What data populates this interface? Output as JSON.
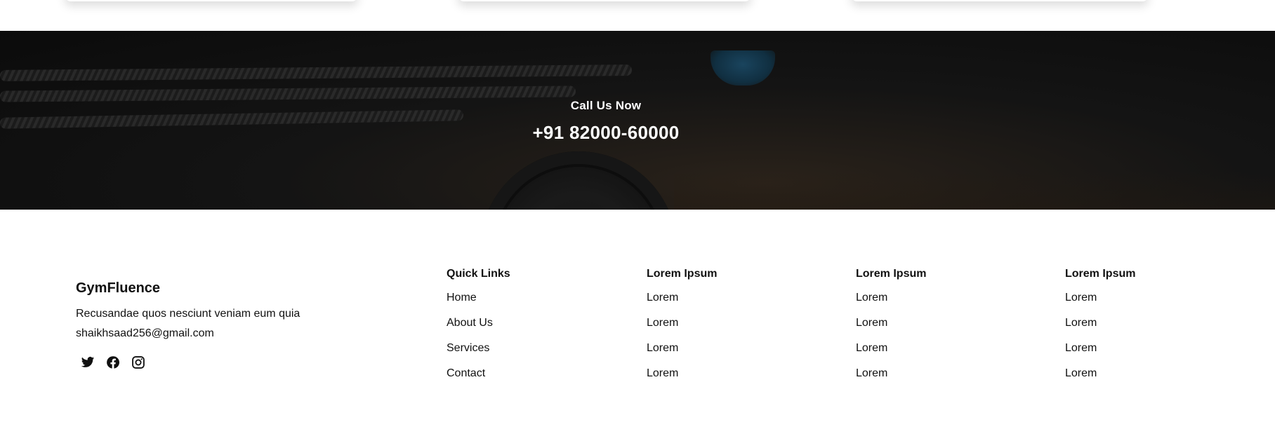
{
  "cta": {
    "label": "Call Us Now",
    "phone": "+91 82000-60000"
  },
  "footer": {
    "brand": "GymFluence",
    "tagline": "Recusandae quos nesciunt veniam eum quia",
    "email": "shaikhsaad256@gmail.com",
    "socials": [
      {
        "icon": "twitter-icon"
      },
      {
        "icon": "facebook-icon"
      },
      {
        "icon": "instagram-icon"
      }
    ],
    "columns": [
      {
        "title": "Quick Links",
        "items": [
          "Home",
          "About Us",
          "Services",
          "Contact"
        ]
      },
      {
        "title": "Lorem Ipsum",
        "items": [
          "Lorem",
          "Lorem",
          "Lorem",
          "Lorem"
        ]
      },
      {
        "title": "Lorem Ipsum",
        "items": [
          "Lorem",
          "Lorem",
          "Lorem",
          "Lorem"
        ]
      },
      {
        "title": "Lorem Ipsum",
        "items": [
          "Lorem",
          "Lorem",
          "Lorem",
          "Lorem"
        ]
      }
    ]
  },
  "colors": {
    "cta_background": "#0b0b0b",
    "text": "#111111",
    "cta_text": "#ffffff"
  }
}
